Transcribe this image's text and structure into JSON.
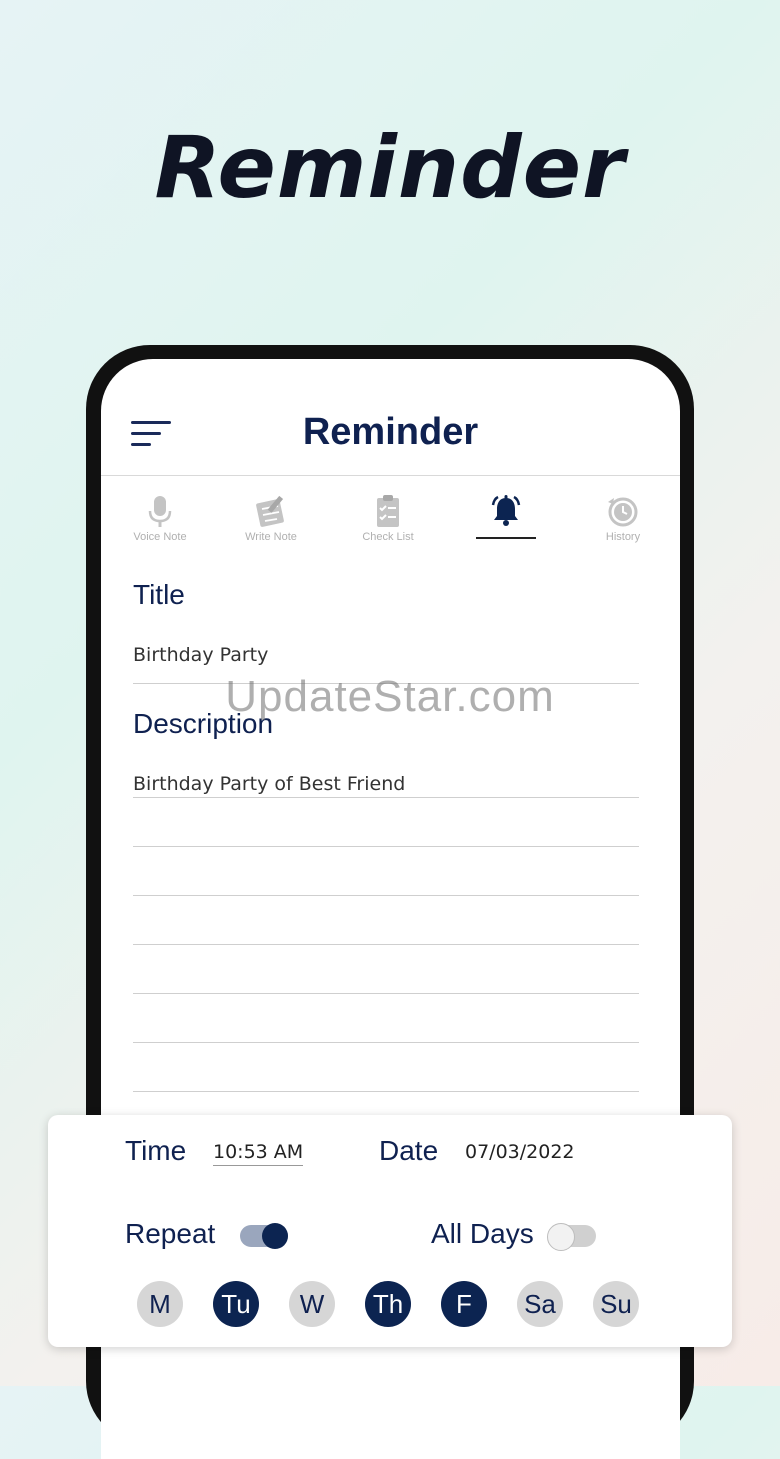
{
  "promo": {
    "title": "Reminder"
  },
  "app": {
    "title": "Reminder"
  },
  "tabs": [
    {
      "label": "Voice Note",
      "icon": "microphone-icon",
      "active": false
    },
    {
      "label": "Write Note",
      "icon": "write-note-icon",
      "active": false
    },
    {
      "label": "Check List",
      "icon": "clipboard-icon",
      "active": false
    },
    {
      "label": "",
      "icon": "bell-icon",
      "active": true
    },
    {
      "label": "History",
      "icon": "history-icon",
      "active": false
    }
  ],
  "form": {
    "title_label": "Title",
    "title_value": "Birthday Party",
    "description_label": "Description",
    "description_value": "Birthday Party of Best Friend"
  },
  "watermark": "UpdateStar.com",
  "schedule": {
    "time_label": "Time",
    "time_value": "10:53 AM",
    "date_label": "Date",
    "date_value": "07/03/2022",
    "repeat_label": "Repeat",
    "repeat_on": true,
    "alldays_label": "All Days",
    "alldays_on": false,
    "days": [
      {
        "label": "M",
        "on": false
      },
      {
        "label": "Tu",
        "on": true
      },
      {
        "label": "W",
        "on": false
      },
      {
        "label": "Th",
        "on": true
      },
      {
        "label": "F",
        "on": true
      },
      {
        "label": "Sa",
        "on": false
      },
      {
        "label": "Su",
        "on": false
      }
    ]
  },
  "colors": {
    "navy": "#0c2451",
    "heading": "#0f2150",
    "inactive_day": "#d6d6d6",
    "toggle_track_off": "#d0d0d0",
    "toggle_knob_off": "#f2f2f2"
  }
}
